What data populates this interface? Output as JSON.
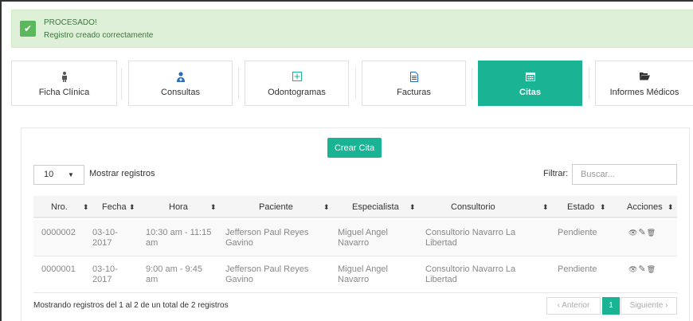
{
  "alert": {
    "title": "PROCESADO!",
    "message": "Registro creado correctamente",
    "check": "✔"
  },
  "tabs": [
    {
      "label": "Ficha Clínica",
      "icon": "person-icon",
      "glyph": "🚹"
    },
    {
      "label": "Consultas",
      "icon": "user-md-icon",
      "glyph": "👤"
    },
    {
      "label": "Odontogramas",
      "icon": "plus-square-icon",
      "glyph": "⊞"
    },
    {
      "label": "Facturas",
      "icon": "file-text-icon",
      "glyph": "▤"
    },
    {
      "label": "Citas",
      "icon": "calendar-icon",
      "glyph": "▦"
    },
    {
      "label": "Informes Médicos",
      "icon": "folder-open-icon",
      "glyph": "▰"
    }
  ],
  "toolbar": {
    "create_label": "Crear Cita",
    "page_length": "10",
    "length_label": "Mostrar registros",
    "filter_label": "Filtrar:",
    "search_placeholder": "Buscar..."
  },
  "table": {
    "columns": [
      "Nro.",
      "Fecha",
      "Hora",
      "Paciente",
      "Especialista",
      "Consultorio",
      "Estado",
      "Acciones"
    ],
    "sort_glyph": "⬍",
    "rows": [
      {
        "nro": "0000002",
        "fecha_1": "03-10-",
        "fecha_2": "2017",
        "hora_1": "10:30 am - 11:15",
        "hora_2": "am",
        "paciente_1": "Jefferson Paul Reyes",
        "paciente_2": "Gavino",
        "especialista_1": "Miguel Angel",
        "especialista_2": "Navarro",
        "consultorio_1": "Consultorio Navarro La",
        "consultorio_2": "Libertad",
        "estado": "Pendiente"
      },
      {
        "nro": "0000001",
        "fecha_1": "03-10-",
        "fecha_2": "2017",
        "hora_1": "9:00 am - 9:45",
        "hora_2": "am",
        "paciente_1": "Jefferson Paul Reyes",
        "paciente_2": "Gavino",
        "especialista_1": "Miguel Angel",
        "especialista_2": "Navarro",
        "consultorio_1": "Consultorio Navarro La",
        "consultorio_2": "Libertad",
        "estado": "Pendiente"
      }
    ],
    "action_glyphs": {
      "view": "👁",
      "edit": "✎",
      "delete": "🗑"
    }
  },
  "footer": {
    "info": "Mostrando registros del 1 al 2 de un total de 2 registros",
    "prev": "‹ Anterior",
    "page": "1",
    "next": "Siguiente ›"
  },
  "colors": {
    "accent": "#1ab394",
    "success_bg": "#dff0d8",
    "success_text": "#3c763d"
  }
}
